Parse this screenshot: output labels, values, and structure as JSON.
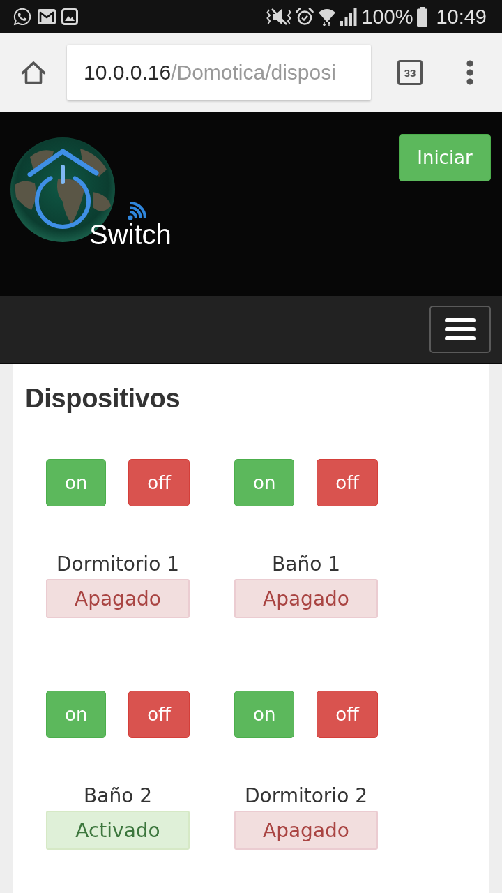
{
  "status_bar": {
    "battery": "100%",
    "time": "10:49"
  },
  "browser": {
    "url_host": "10.0.0.16",
    "url_path": "/Domotica/disposi",
    "tab_count": "33"
  },
  "header": {
    "logo_text": "Switch",
    "login_button": "Iniciar"
  },
  "page": {
    "title": "Dispositivos",
    "devices": [
      {
        "name": "Dormitorio 1",
        "buttons": [
          {
            "label": "on",
            "kind": "on"
          },
          {
            "label": "off",
            "kind": "off"
          }
        ],
        "status": "Apagado",
        "on": false
      },
      {
        "name": "Baño 1",
        "buttons": [
          {
            "label": "on",
            "kind": "on"
          },
          {
            "label": "off",
            "kind": "off"
          }
        ],
        "status": "Apagado",
        "on": false
      },
      {
        "name": "Baño 2",
        "buttons": [
          {
            "label": "on",
            "kind": "on"
          },
          {
            "label": "off",
            "kind": "off"
          }
        ],
        "status": "Activado",
        "on": true
      },
      {
        "name": "Dormitorio 2",
        "buttons": [
          {
            "label": "on",
            "kind": "on"
          },
          {
            "label": "off",
            "kind": "off"
          }
        ],
        "status": "Apagado",
        "on": false
      }
    ]
  }
}
